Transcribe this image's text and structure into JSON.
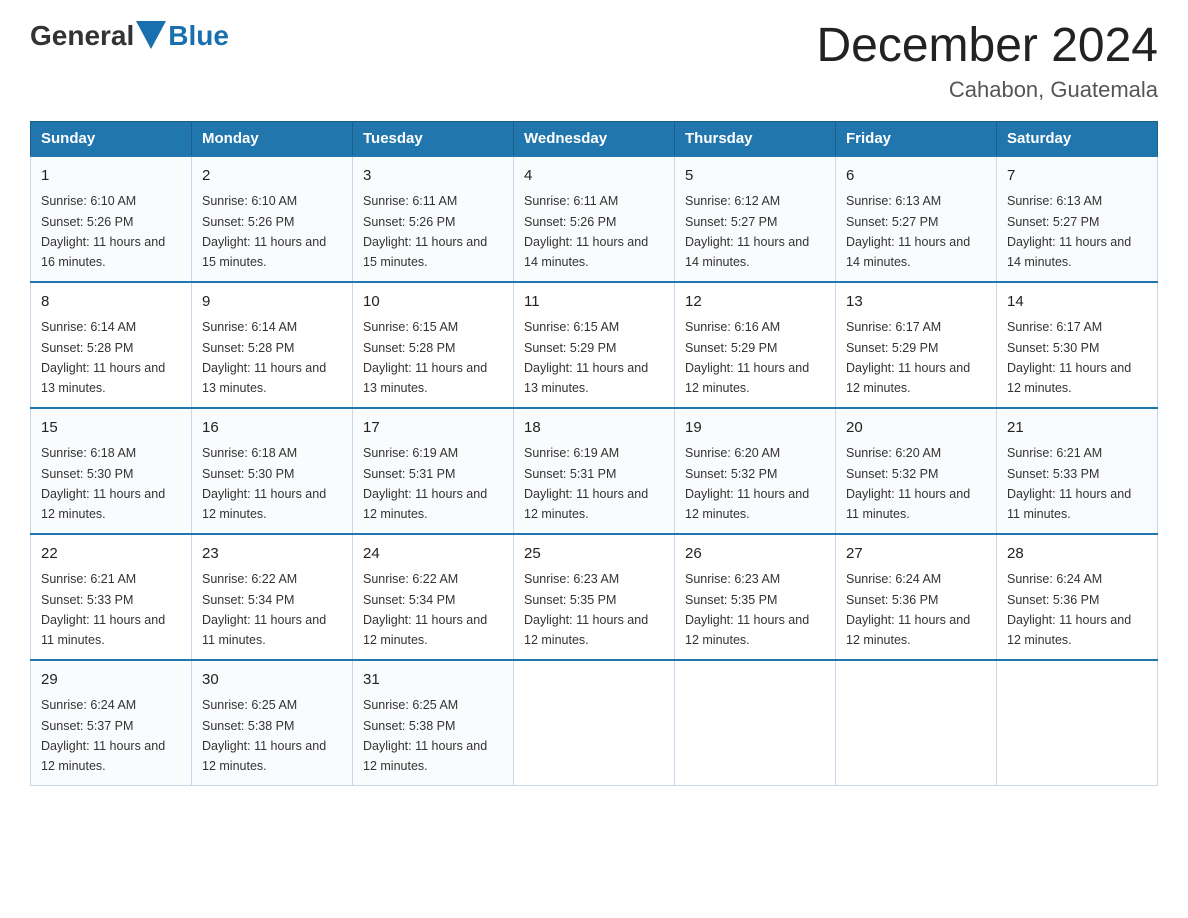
{
  "header": {
    "logo_general": "General",
    "logo_blue": "Blue",
    "title": "December 2024",
    "location": "Cahabon, Guatemala"
  },
  "days_of_week": [
    "Sunday",
    "Monday",
    "Tuesday",
    "Wednesday",
    "Thursday",
    "Friday",
    "Saturday"
  ],
  "weeks": [
    [
      {
        "day": "1",
        "sunrise": "6:10 AM",
        "sunset": "5:26 PM",
        "daylight": "11 hours and 16 minutes."
      },
      {
        "day": "2",
        "sunrise": "6:10 AM",
        "sunset": "5:26 PM",
        "daylight": "11 hours and 15 minutes."
      },
      {
        "day": "3",
        "sunrise": "6:11 AM",
        "sunset": "5:26 PM",
        "daylight": "11 hours and 15 minutes."
      },
      {
        "day": "4",
        "sunrise": "6:11 AM",
        "sunset": "5:26 PM",
        "daylight": "11 hours and 14 minutes."
      },
      {
        "day": "5",
        "sunrise": "6:12 AM",
        "sunset": "5:27 PM",
        "daylight": "11 hours and 14 minutes."
      },
      {
        "day": "6",
        "sunrise": "6:13 AM",
        "sunset": "5:27 PM",
        "daylight": "11 hours and 14 minutes."
      },
      {
        "day": "7",
        "sunrise": "6:13 AM",
        "sunset": "5:27 PM",
        "daylight": "11 hours and 14 minutes."
      }
    ],
    [
      {
        "day": "8",
        "sunrise": "6:14 AM",
        "sunset": "5:28 PM",
        "daylight": "11 hours and 13 minutes."
      },
      {
        "day": "9",
        "sunrise": "6:14 AM",
        "sunset": "5:28 PM",
        "daylight": "11 hours and 13 minutes."
      },
      {
        "day": "10",
        "sunrise": "6:15 AM",
        "sunset": "5:28 PM",
        "daylight": "11 hours and 13 minutes."
      },
      {
        "day": "11",
        "sunrise": "6:15 AM",
        "sunset": "5:29 PM",
        "daylight": "11 hours and 13 minutes."
      },
      {
        "day": "12",
        "sunrise": "6:16 AM",
        "sunset": "5:29 PM",
        "daylight": "11 hours and 12 minutes."
      },
      {
        "day": "13",
        "sunrise": "6:17 AM",
        "sunset": "5:29 PM",
        "daylight": "11 hours and 12 minutes."
      },
      {
        "day": "14",
        "sunrise": "6:17 AM",
        "sunset": "5:30 PM",
        "daylight": "11 hours and 12 minutes."
      }
    ],
    [
      {
        "day": "15",
        "sunrise": "6:18 AM",
        "sunset": "5:30 PM",
        "daylight": "11 hours and 12 minutes."
      },
      {
        "day": "16",
        "sunrise": "6:18 AM",
        "sunset": "5:30 PM",
        "daylight": "11 hours and 12 minutes."
      },
      {
        "day": "17",
        "sunrise": "6:19 AM",
        "sunset": "5:31 PM",
        "daylight": "11 hours and 12 minutes."
      },
      {
        "day": "18",
        "sunrise": "6:19 AM",
        "sunset": "5:31 PM",
        "daylight": "11 hours and 12 minutes."
      },
      {
        "day": "19",
        "sunrise": "6:20 AM",
        "sunset": "5:32 PM",
        "daylight": "11 hours and 12 minutes."
      },
      {
        "day": "20",
        "sunrise": "6:20 AM",
        "sunset": "5:32 PM",
        "daylight": "11 hours and 11 minutes."
      },
      {
        "day": "21",
        "sunrise": "6:21 AM",
        "sunset": "5:33 PM",
        "daylight": "11 hours and 11 minutes."
      }
    ],
    [
      {
        "day": "22",
        "sunrise": "6:21 AM",
        "sunset": "5:33 PM",
        "daylight": "11 hours and 11 minutes."
      },
      {
        "day": "23",
        "sunrise": "6:22 AM",
        "sunset": "5:34 PM",
        "daylight": "11 hours and 11 minutes."
      },
      {
        "day": "24",
        "sunrise": "6:22 AM",
        "sunset": "5:34 PM",
        "daylight": "11 hours and 12 minutes."
      },
      {
        "day": "25",
        "sunrise": "6:23 AM",
        "sunset": "5:35 PM",
        "daylight": "11 hours and 12 minutes."
      },
      {
        "day": "26",
        "sunrise": "6:23 AM",
        "sunset": "5:35 PM",
        "daylight": "11 hours and 12 minutes."
      },
      {
        "day": "27",
        "sunrise": "6:24 AM",
        "sunset": "5:36 PM",
        "daylight": "11 hours and 12 minutes."
      },
      {
        "day": "28",
        "sunrise": "6:24 AM",
        "sunset": "5:36 PM",
        "daylight": "11 hours and 12 minutes."
      }
    ],
    [
      {
        "day": "29",
        "sunrise": "6:24 AM",
        "sunset": "5:37 PM",
        "daylight": "11 hours and 12 minutes."
      },
      {
        "day": "30",
        "sunrise": "6:25 AM",
        "sunset": "5:38 PM",
        "daylight": "11 hours and 12 minutes."
      },
      {
        "day": "31",
        "sunrise": "6:25 AM",
        "sunset": "5:38 PM",
        "daylight": "11 hours and 12 minutes."
      },
      null,
      null,
      null,
      null
    ]
  ]
}
